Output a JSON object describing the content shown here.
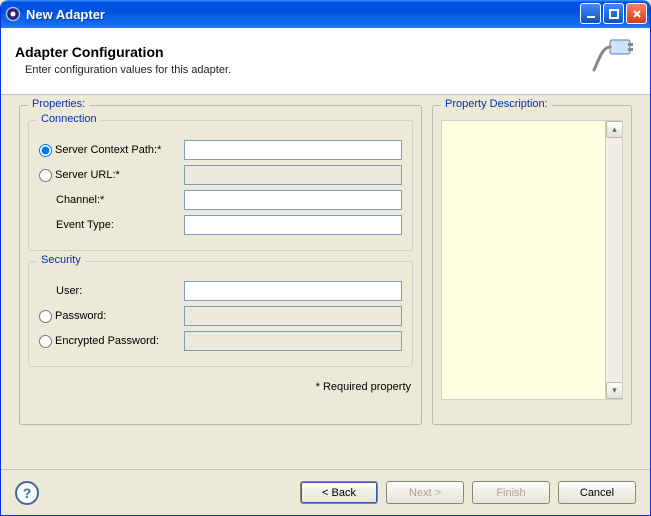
{
  "window": {
    "title": "New Adapter"
  },
  "header": {
    "title": "Adapter Configuration",
    "subtitle": "Enter configuration values for this adapter."
  },
  "properties": {
    "legend": "Properties:",
    "connection": {
      "legend": "Connection",
      "server_context_path_label": "Server Context Path:*",
      "server_context_path_value": "",
      "server_url_label": "Server URL:*",
      "server_url_value": "",
      "channel_label": "Channel:*",
      "channel_value": "",
      "event_type_label": "Event Type:",
      "event_type_value": ""
    },
    "security": {
      "legend": "Security",
      "user_label": "User:",
      "user_value": "",
      "password_label": "Password:",
      "password_value": "",
      "encrypted_password_label": "Encrypted Password:",
      "encrypted_password_value": ""
    },
    "required_note": "* Required property"
  },
  "description": {
    "legend": "Property Description:",
    "text": ""
  },
  "buttons": {
    "back": "< Back",
    "next": "Next >",
    "finish": "Finish",
    "cancel": "Cancel"
  }
}
